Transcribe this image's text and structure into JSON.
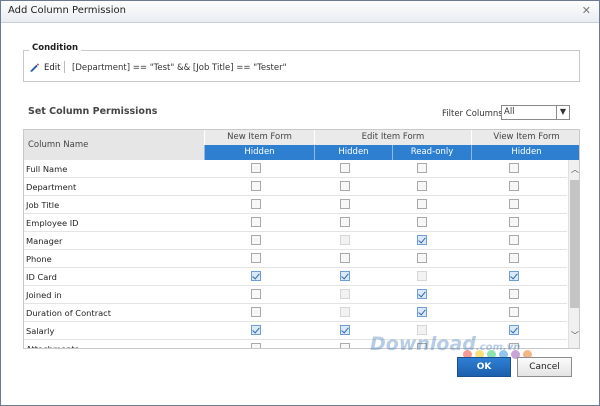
{
  "window": {
    "title": "Add Column Permission",
    "close_glyph": "✕"
  },
  "condition": {
    "legend": "Condition",
    "edit_label": "Edit",
    "expression": "[Department] == \"Test\" && [Job Title] == \"Tester\""
  },
  "permissions": {
    "title": "Set Column Permissions",
    "filter_label": "Filter Columns",
    "filter_value": "All",
    "column_name_header": "Column Name",
    "groups": [
      {
        "label": "New Item Form",
        "subs": [
          "Hidden"
        ]
      },
      {
        "label": "Edit Item Form",
        "subs": [
          "Hidden",
          "Read-only"
        ]
      },
      {
        "label": "View Item Form",
        "subs": [
          "Hidden"
        ]
      }
    ],
    "rows": [
      {
        "name": "Full Name",
        "states": [
          "off",
          "off",
          "off",
          "off"
        ]
      },
      {
        "name": "Department",
        "states": [
          "off",
          "off",
          "off",
          "off"
        ]
      },
      {
        "name": "Job Title",
        "states": [
          "off",
          "off",
          "off",
          "off"
        ]
      },
      {
        "name": "Employee ID",
        "states": [
          "off",
          "off",
          "off",
          "off"
        ]
      },
      {
        "name": "Manager",
        "states": [
          "off",
          "dis",
          "on",
          "off"
        ]
      },
      {
        "name": "Phone",
        "states": [
          "off",
          "off",
          "off",
          "off"
        ]
      },
      {
        "name": "ID Card",
        "states": [
          "on",
          "on",
          "dis",
          "on"
        ]
      },
      {
        "name": "Joined in",
        "states": [
          "off",
          "dis",
          "on",
          "off"
        ]
      },
      {
        "name": "Duration of Contract",
        "states": [
          "off",
          "dis",
          "on",
          "off"
        ]
      },
      {
        "name": "Salarly",
        "states": [
          "on",
          "on",
          "dis",
          "on"
        ]
      },
      {
        "name": "Attachments",
        "states": [
          "off",
          "off",
          "off",
          "off"
        ]
      }
    ]
  },
  "buttons": {
    "ok": "OK",
    "cancel": "Cancel"
  },
  "watermark": {
    "text": "Download",
    "suffix": ".com.vn"
  },
  "colors": {
    "header_blue": "#2f7fd0",
    "dots": [
      "#e74c3c",
      "#f1c40f",
      "#2ecc71",
      "#3498db",
      "#9b59b6",
      "#e67e22"
    ]
  }
}
